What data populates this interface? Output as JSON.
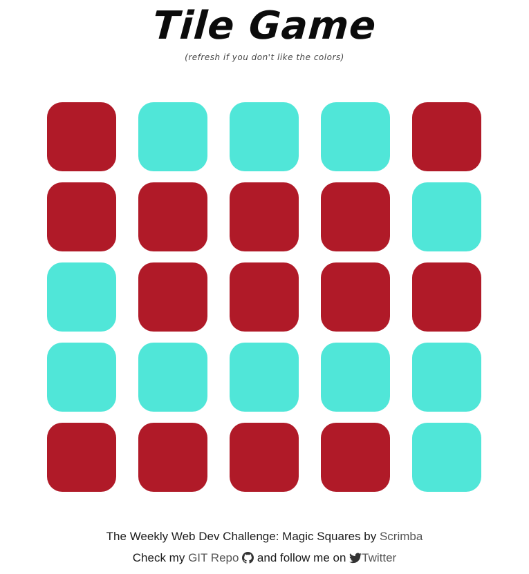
{
  "header": {
    "title": "Tile Game",
    "subtitle": "(refresh if you don't like the colors)"
  },
  "colors": {
    "red": "#b01a28",
    "teal": "#50e6d8",
    "link": "#555555",
    "text": "#1b1b1b"
  },
  "board": {
    "rows": 5,
    "cols": 5,
    "tiles": [
      [
        "red",
        "teal",
        "teal",
        "teal",
        "red"
      ],
      [
        "red",
        "red",
        "red",
        "red",
        "teal"
      ],
      [
        "teal",
        "red",
        "red",
        "red",
        "red"
      ],
      [
        "teal",
        "teal",
        "teal",
        "teal",
        "teal"
      ],
      [
        "red",
        "red",
        "red",
        "red",
        "teal"
      ]
    ]
  },
  "footer": {
    "line1_prefix": "The Weekly Web Dev Challenge: Magic Squares by ",
    "scrimba_link": "Scrimba",
    "line2_prefix": "Check my ",
    "repo_link": "GIT Repo",
    "line2_middle": " and follow me on ",
    "twitter_link": "Twitter",
    "repo_icon": "github-icon",
    "twitter_icon": "twitter-icon"
  }
}
